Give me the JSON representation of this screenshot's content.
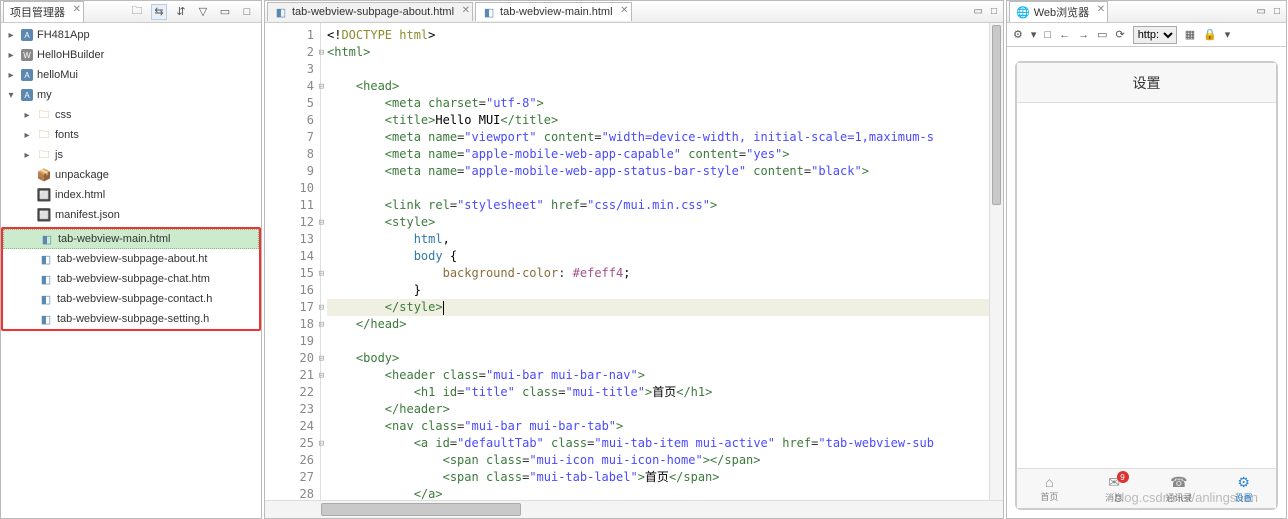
{
  "project_explorer": {
    "title": "项目管理器",
    "toolbar": [
      "🗀",
      "⇆",
      "⇵",
      "▽",
      "▭",
      "□"
    ],
    "roots": [
      {
        "icon": "A",
        "name": "FH481App",
        "exp": "▸"
      },
      {
        "icon": "W",
        "name": "HelloHBuilder",
        "exp": "▸"
      },
      {
        "icon": "A",
        "name": "helloMui",
        "exp": "▸"
      },
      {
        "icon": "A",
        "name": "my",
        "exp": "▾"
      }
    ],
    "folders": [
      {
        "name": "css",
        "exp": "▸"
      },
      {
        "name": "fonts",
        "exp": "▸"
      },
      {
        "name": "js",
        "exp": "▸"
      }
    ],
    "files_top": [
      {
        "ico": "📦",
        "name": "unpackage"
      },
      {
        "ico": "🔲",
        "name": "index.html"
      },
      {
        "ico": "🔲",
        "name": "manifest.json"
      }
    ],
    "files_box": [
      {
        "name": "tab-webview-main.html",
        "sel": true
      },
      {
        "name": "tab-webview-subpage-about.ht",
        "sel": false
      },
      {
        "name": "tab-webview-subpage-chat.htm",
        "sel": false
      },
      {
        "name": "tab-webview-subpage-contact.h",
        "sel": false
      },
      {
        "name": "tab-webview-subpage-setting.h",
        "sel": false
      }
    ]
  },
  "editor": {
    "tabs": [
      {
        "name": "tab-webview-subpage-about.html",
        "active": false
      },
      {
        "name": "tab-webview-main.html",
        "active": true
      }
    ],
    "line_start": 1,
    "line_end": 28,
    "fold_lines": [
      2,
      4,
      12,
      15,
      17,
      18,
      20,
      21,
      25
    ],
    "cursor_line": 17,
    "lines": [
      {
        "h": "<span class='txt'>&lt;!</span><span class='doctype'>DOCTYPE html</span><span class='txt'>&gt;</span>"
      },
      {
        "h": "<span class='tag'>&lt;html&gt;</span>"
      },
      {
        "h": ""
      },
      {
        "h": "    <span class='tag'>&lt;head&gt;</span>"
      },
      {
        "h": "        <span class='tag'>&lt;meta</span> <span class='attn'>charset</span>=<span class='attv'>\"utf-8\"</span><span class='tag'>&gt;</span>"
      },
      {
        "h": "        <span class='tag'>&lt;title&gt;</span><span class='txt'>Hello MUI</span><span class='tag'>&lt;/title&gt;</span>"
      },
      {
        "h": "        <span class='tag'>&lt;meta</span> <span class='attn'>name</span>=<span class='attv'>\"viewport\"</span> <span class='attn'>content</span>=<span class='attv'>\"width=device-width, initial-scale=1,maximum-s</span>"
      },
      {
        "h": "        <span class='tag'>&lt;meta</span> <span class='attn'>name</span>=<span class='attv'>\"apple-mobile-web-app-capable\"</span> <span class='attn'>content</span>=<span class='attv'>\"yes\"</span><span class='tag'>&gt;</span>"
      },
      {
        "h": "        <span class='tag'>&lt;meta</span> <span class='attn'>name</span>=<span class='attv'>\"apple-mobile-web-app-status-bar-style\"</span> <span class='attn'>content</span>=<span class='attv'>\"black\"</span><span class='tag'>&gt;</span>"
      },
      {
        "h": ""
      },
      {
        "h": "        <span class='tag'>&lt;link</span> <span class='attn'>rel</span>=<span class='attv'>\"stylesheet\"</span> <span class='attn'>href</span>=<span class='attv'>\"css/mui.min.css\"</span><span class='tag'>&gt;</span>"
      },
      {
        "h": "        <span class='tag'>&lt;style&gt;</span>"
      },
      {
        "h": "            <span class='css-sel'>html</span><span class='txt'>,</span>"
      },
      {
        "h": "            <span class='css-sel'>body</span> <span class='txt'>{</span>"
      },
      {
        "h": "                <span class='css-prop'>background-color</span>: <span class='css-val'>#efeff4</span><span class='txt'>;</span>"
      },
      {
        "h": "            <span class='txt'>}</span>"
      },
      {
        "h": "        <span class='tag'>&lt;/style&gt;</span><span style='border-left:1px solid #000;display:inline-block;height:14px;vertical-align:middle'></span>"
      },
      {
        "h": "    <span class='tag'>&lt;/head&gt;</span>"
      },
      {
        "h": ""
      },
      {
        "h": "    <span class='tag'>&lt;body&gt;</span>"
      },
      {
        "h": "        <span class='tag'>&lt;header</span> <span class='attn'>class</span>=<span class='attv'>\"mui-bar mui-bar-nav\"</span><span class='tag'>&gt;</span>"
      },
      {
        "h": "            <span class='tag'>&lt;h1</span> <span class='attn'>id</span>=<span class='attv'>\"title\"</span> <span class='attn'>class</span>=<span class='attv'>\"mui-title\"</span><span class='tag'>&gt;</span><span class='txt'>首页</span><span class='tag'>&lt;/h1&gt;</span>"
      },
      {
        "h": "        <span class='tag'>&lt;/header&gt;</span>"
      },
      {
        "h": "        <span class='tag'>&lt;nav</span> <span class='attn'>class</span>=<span class='attv'>\"mui-bar mui-bar-tab\"</span><span class='tag'>&gt;</span>"
      },
      {
        "h": "            <span class='tag'>&lt;a</span> <span class='attn'>id</span>=<span class='attv'>\"defaultTab\"</span> <span class='attn'>class</span>=<span class='attv'>\"mui-tab-item mui-active\"</span> <span class='attn'>href</span>=<span class='attv'>\"tab-webview-sub</span>"
      },
      {
        "h": "                <span class='tag'>&lt;span</span> <span class='attn'>class</span>=<span class='attv'>\"mui-icon mui-icon-home\"</span><span class='tag'>&gt;&lt;/span&gt;</span>"
      },
      {
        "h": "                <span class='tag'>&lt;span</span> <span class='attn'>class</span>=<span class='attv'>\"mui-tab-label\"</span><span class='tag'>&gt;</span><span class='txt'>首页</span><span class='tag'>&lt;/span&gt;</span>"
      },
      {
        "h": "            <span class='tag'>&lt;/a&gt;</span>"
      }
    ]
  },
  "browser": {
    "title": "Web浏览器",
    "protocol": "http:",
    "toolbar_icons": [
      "⚙",
      "▾",
      "□",
      "←",
      "→",
      "▭",
      "⟳"
    ],
    "toolbar_right": [
      "▦",
      "🔒",
      "▾"
    ],
    "phone_title": "设置",
    "tabs": [
      {
        "ico": "⌂",
        "label": "首页",
        "active": false,
        "badge": null
      },
      {
        "ico": "✉",
        "label": "消息",
        "active": false,
        "badge": "9"
      },
      {
        "ico": "☎",
        "label": "通讯录",
        "active": false,
        "badge": null
      },
      {
        "ico": "⚙",
        "label": "设置",
        "active": true,
        "badge": null
      }
    ]
  },
  "watermark": "blog.csdn.net/anlingshen"
}
